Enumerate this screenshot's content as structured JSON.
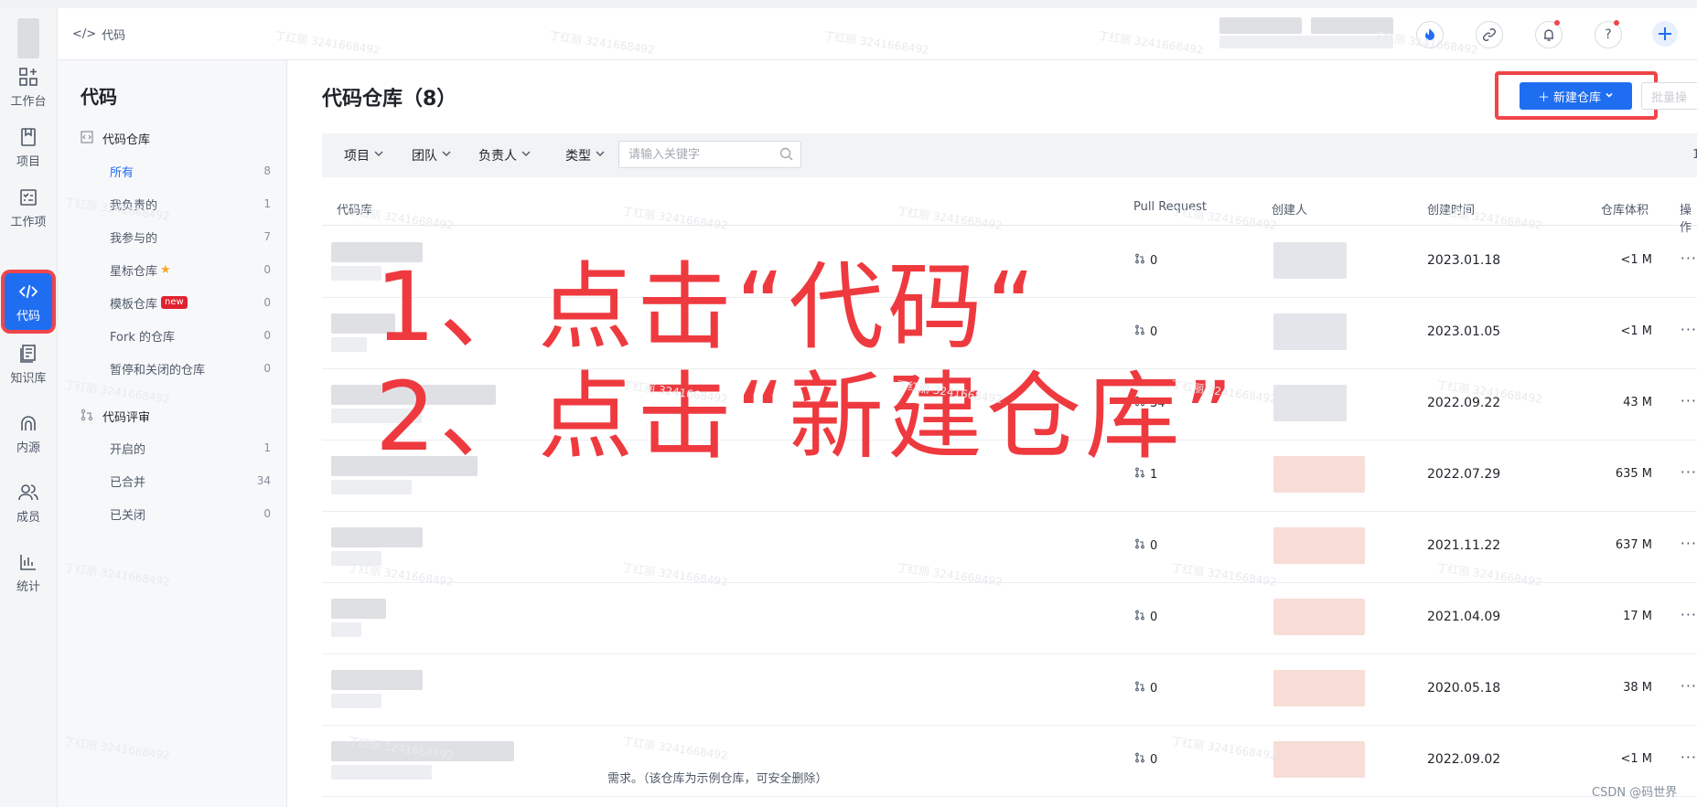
{
  "rail": {
    "items": [
      {
        "label": "工作台",
        "icon": "workbench-icon"
      },
      {
        "label": "项目",
        "icon": "project-icon"
      },
      {
        "label": "工作项",
        "icon": "workitem-icon"
      },
      {
        "label": "代码",
        "icon": "code-icon"
      },
      {
        "label": "知识库",
        "icon": "knowledge-icon"
      },
      {
        "label": "内源",
        "icon": "innersource-icon"
      },
      {
        "label": "成员",
        "icon": "members-icon"
      },
      {
        "label": "统计",
        "icon": "stats-icon"
      }
    ],
    "active": "代码"
  },
  "topbar": {
    "breadcrumb": "代码"
  },
  "sidebar": {
    "title": "代码",
    "groups": [
      {
        "label": "代码仓库",
        "items": [
          {
            "label": "所有",
            "count": "8"
          },
          {
            "label": "我负责的",
            "count": "1"
          },
          {
            "label": "我参与的",
            "count": "7"
          },
          {
            "label": "星标仓库",
            "count": "0"
          },
          {
            "label": "模板仓库",
            "count": "0",
            "badge": "new"
          },
          {
            "label": "Fork 的仓库",
            "count": "0"
          },
          {
            "label": "暂停和关闭的仓库",
            "count": "0"
          }
        ]
      },
      {
        "label": "代码评审",
        "items": [
          {
            "label": "开启的",
            "count": "1"
          },
          {
            "label": "已合并",
            "count": "34"
          },
          {
            "label": "已关闭",
            "count": "0"
          }
        ]
      }
    ]
  },
  "main": {
    "title": "代码仓库（8）",
    "new_button": "新建仓库",
    "batch_button": "批量操",
    "filters": [
      "项目",
      "团队",
      "负责人",
      "类型"
    ],
    "search_placeholder": "请输入关键字",
    "page_indicator": "1",
    "columns": [
      "代码库",
      "Pull Request",
      "创建人",
      "创建时间",
      "仓库体积",
      "操作"
    ],
    "rows": [
      {
        "pr": "0",
        "date": "2023.01.18",
        "size": "<1 M"
      },
      {
        "pr": "0",
        "date": "2023.01.05",
        "size": "<1 M"
      },
      {
        "pr": "34",
        "date": "2022.09.22",
        "size": "43 M"
      },
      {
        "pr": "1",
        "date": "2022.07.29",
        "size": "635 M"
      },
      {
        "pr": "0",
        "date": "2021.11.22",
        "size": "637 M"
      },
      {
        "pr": "0",
        "date": "2021.04.09",
        "size": "17 M"
      },
      {
        "pr": "0",
        "date": "2020.05.18",
        "size": "38 M"
      },
      {
        "pr": "0",
        "date": "2022.09.02",
        "size": "<1 M",
        "desc": "需求。（该仓库为示例仓库，可安全删除）"
      }
    ]
  },
  "annotation": {
    "line1": "1、点击“代码“",
    "line2": "2、点击“新建仓库”",
    "color": "#ee3a3f"
  },
  "watermark": "丁红丽 3241668492",
  "footer_credit": "CSDN @码世界",
  "colors": {
    "accent": "#1f6ef2",
    "highlight": "#f0454a"
  }
}
